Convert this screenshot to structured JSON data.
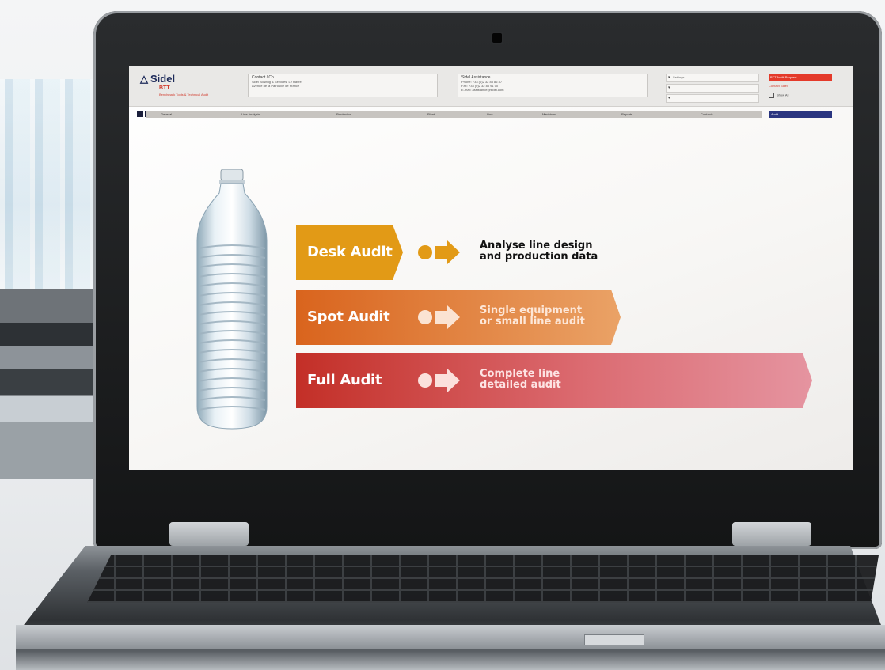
{
  "header": {
    "logo_text": "Sidel",
    "logo_sub": "BTT",
    "logo_tagline": "Benchmark Tools & Technical Audit",
    "contact_box": {
      "title": "Contact / Co.",
      "lines": [
        "Sidel Blowing & Services, Le Havre",
        "Avenue de la Patrouille de France"
      ]
    },
    "assist_box": {
      "title": "Sidel Assistance",
      "lines": [
        "Phone: +33 (0)2 32 85 86 87",
        "Fax: +33 (0)2 32 85 91 00",
        "E-mail: assistance@sidel.com"
      ]
    },
    "selects": [
      "Settings",
      "",
      ""
    ],
    "red_bar_label": "BTT Audit Request",
    "red_text": "Contact Sidel",
    "checkbox_label": "Show All"
  },
  "nav": {
    "items": [
      "General",
      "Line Analysis",
      "Production",
      "Plant",
      "Line",
      "Machines",
      "Reports",
      "Contacts"
    ],
    "final_item": "Audit"
  },
  "audits": [
    {
      "label": "Desk Audit",
      "desc_line1": "Analyse line design",
      "desc_line2": "and production data"
    },
    {
      "label": "Spot Audit",
      "desc_line1": "Single equipment",
      "desc_line2": "or small line audit"
    },
    {
      "label": "Full Audit",
      "desc_line1": "Complete line",
      "desc_line2": "detailed audit"
    }
  ],
  "colors": {
    "desk": "#e29a16",
    "spot": "#de6b1f",
    "full": "#c7362a",
    "brand_navy": "#1d2a5a",
    "brand_red": "#e43a2a"
  }
}
